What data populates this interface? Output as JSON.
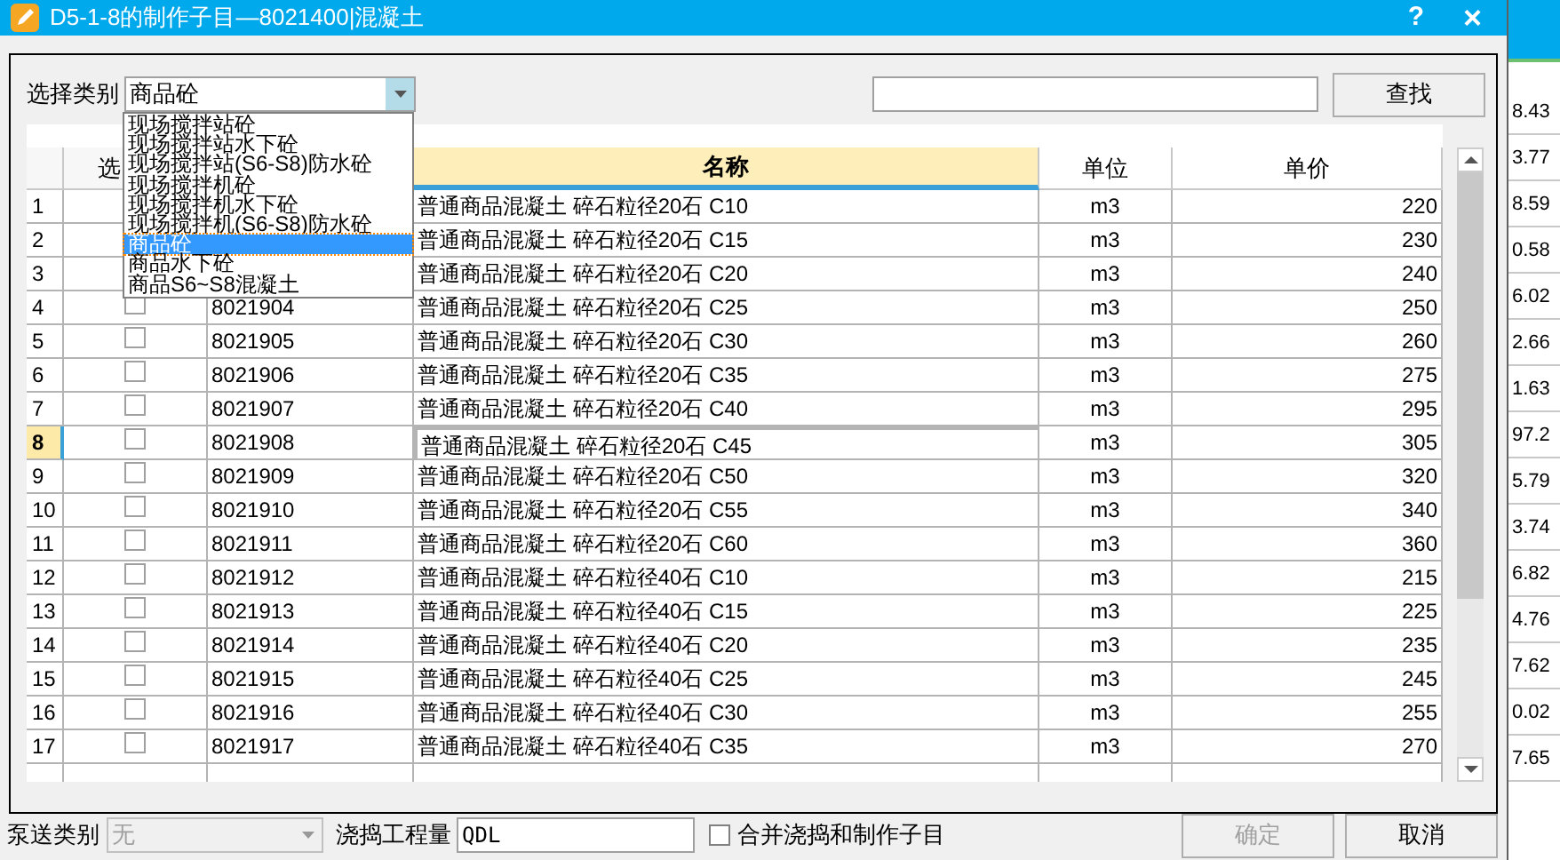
{
  "window": {
    "title": "D5-1-8的制作子目—8021400|混凝土",
    "help": "?",
    "close": "×"
  },
  "category": {
    "label": "选择类别",
    "value": "商品砼",
    "expanded": true,
    "options": [
      {
        "label": "现场搅拌站砼",
        "selected": false
      },
      {
        "label": "现场搅拌站水下砼",
        "selected": false
      },
      {
        "label": "现场搅拌站(S6-S8)防水砼",
        "selected": false
      },
      {
        "label": "现场搅拌机砼",
        "selected": false
      },
      {
        "label": "现场搅拌机水下砼",
        "selected": false
      },
      {
        "label": "现场搅拌机(S6-S8)防水砼",
        "selected": false
      },
      {
        "label": "商品砼",
        "selected": true
      },
      {
        "label": "商品水下砼",
        "selected": false
      },
      {
        "label": "商品S6~S8混凝土",
        "selected": false
      }
    ]
  },
  "search": {
    "button": "查找"
  },
  "table": {
    "columns": [
      "选",
      "名称",
      "单位",
      "单价"
    ],
    "rows": [
      {
        "index": "1",
        "name": "普通商品混凝土 碎石粒径20石 C10",
        "unit": "m3",
        "price": "220",
        "selected": false
      },
      {
        "index": "2",
        "name": "普通商品混凝土 碎石粒径20石 C15",
        "unit": "m3",
        "price": "230",
        "selected": false
      },
      {
        "index": "3",
        "name": "普通商品混凝土 碎石粒径20石 C20",
        "unit": "m3",
        "price": "240",
        "selected": false
      },
      {
        "index": "4",
        "checked": false,
        "code": "8021904",
        "name": "普通商品混凝土 碎石粒径20石 C25",
        "unit": "m3",
        "price": "250",
        "selected": false
      },
      {
        "index": "5",
        "checked": false,
        "code": "8021905",
        "name": "普通商品混凝土 碎石粒径20石 C30",
        "unit": "m3",
        "price": "260",
        "selected": false
      },
      {
        "index": "6",
        "checked": false,
        "code": "8021906",
        "name": "普通商品混凝土 碎石粒径20石 C35",
        "unit": "m3",
        "price": "275",
        "selected": false
      },
      {
        "index": "7",
        "checked": false,
        "code": "8021907",
        "name": "普通商品混凝土 碎石粒径20石 C40",
        "unit": "m3",
        "price": "295",
        "selected": false
      },
      {
        "index": "8",
        "checked": false,
        "code": "8021908",
        "name": "普通商品混凝土 碎石粒径20石 C45",
        "unit": "m3",
        "price": "305",
        "selected": true
      },
      {
        "index": "9",
        "checked": false,
        "code": "8021909",
        "name": "普通商品混凝土 碎石粒径20石 C50",
        "unit": "m3",
        "price": "320",
        "selected": false
      },
      {
        "index": "10",
        "checked": false,
        "code": "8021910",
        "name": "普通商品混凝土 碎石粒径20石 C55",
        "unit": "m3",
        "price": "340",
        "selected": false
      },
      {
        "index": "11",
        "checked": false,
        "code": "8021911",
        "name": "普通商品混凝土 碎石粒径20石 C60",
        "unit": "m3",
        "price": "360",
        "selected": false
      },
      {
        "index": "12",
        "checked": false,
        "code": "8021912",
        "name": "普通商品混凝土 碎石粒径40石 C10",
        "unit": "m3",
        "price": "215",
        "selected": false
      },
      {
        "index": "13",
        "checked": false,
        "code": "8021913",
        "name": "普通商品混凝土 碎石粒径40石 C15",
        "unit": "m3",
        "price": "225",
        "selected": false
      },
      {
        "index": "14",
        "checked": false,
        "code": "8021914",
        "name": "普通商品混凝土 碎石粒径40石 C20",
        "unit": "m3",
        "price": "235",
        "selected": false
      },
      {
        "index": "15",
        "checked": false,
        "code": "8021915",
        "name": "普通商品混凝土 碎石粒径40石 C25",
        "unit": "m3",
        "price": "245",
        "selected": false
      },
      {
        "index": "16",
        "checked": false,
        "code": "8021916",
        "name": "普通商品混凝土 碎石粒径40石 C30",
        "unit": "m3",
        "price": "255",
        "selected": false
      },
      {
        "index": "17",
        "checked": false,
        "code": "8021917",
        "name": "普通商品混凝土 碎石粒径40石 C35",
        "unit": "m3",
        "price": "270",
        "selected": false
      }
    ]
  },
  "pump": {
    "label": "泵送类别",
    "value": "无",
    "disabled": true
  },
  "quantity": {
    "label": "浇捣工程量",
    "value": "QDL"
  },
  "merge": {
    "label": "合并浇捣和制作子目",
    "checked": false
  },
  "buttons": [
    {
      "label": "确定",
      "disabled": true
    },
    {
      "label": "取消",
      "disabled": false
    }
  ],
  "background_values": [
    "8.43",
    "3.77",
    "8.59",
    "0.58",
    "6.02",
    "2.66",
    "1.63",
    "97.2",
    "5.79",
    "3.74",
    "6.82",
    "4.76",
    "7.62",
    "0.02",
    "7.65"
  ]
}
